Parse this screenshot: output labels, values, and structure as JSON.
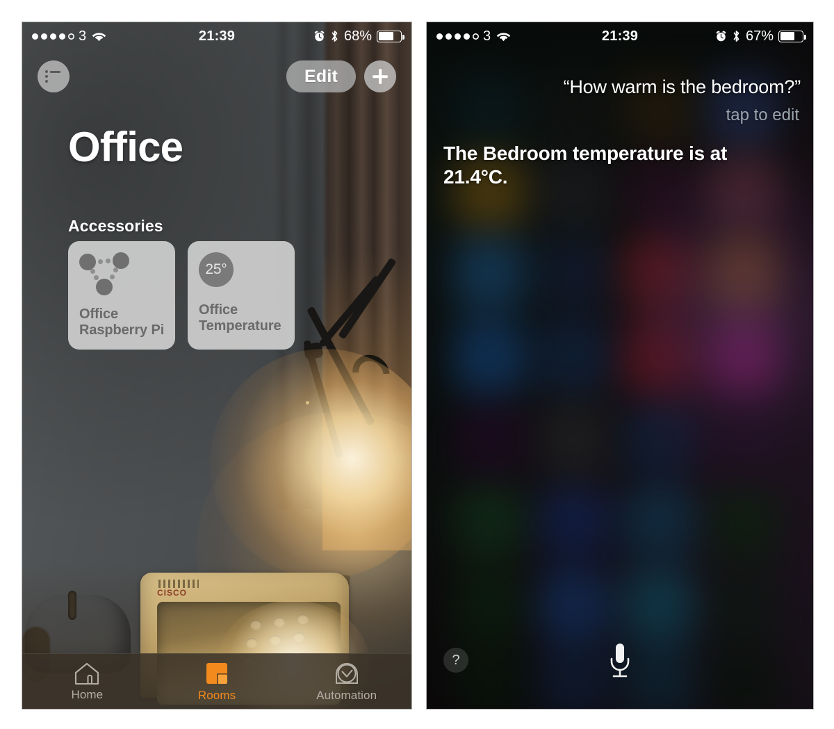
{
  "home_screen": {
    "status_bar": {
      "signal_dots_filled": 4,
      "signal_dots_total": 5,
      "carrier": "3",
      "wifi_icon": "wifi-icon",
      "time": "21:39",
      "alarm_icon": "alarm-clock-icon",
      "bluetooth_icon": "bluetooth-icon",
      "battery_percent": "68%",
      "battery_level": 68
    },
    "nav": {
      "list_icon": "list-icon",
      "edit_label": "Edit",
      "add_icon": "plus-icon"
    },
    "room_title": "Office",
    "accessories_header": "Accessories",
    "accessories": [
      {
        "icon": "raspberry-pi-icon",
        "name_line1": "Office",
        "name_line2": "Raspberry Pi"
      },
      {
        "icon": "temperature-badge",
        "badge_value": "25°",
        "name_line1": "Office",
        "name_line2": "Temperature"
      }
    ],
    "tab_bar": {
      "active": "Rooms",
      "accent_color": "#f28a1e",
      "inactive_color": "#b3ada3",
      "tabs": [
        {
          "label": "Home",
          "icon": "house-icon",
          "active": false
        },
        {
          "label": "Rooms",
          "icon": "rooms-icon",
          "active": true
        },
        {
          "label": "Automation",
          "icon": "automation-clock-icon",
          "active": false
        }
      ]
    }
  },
  "siri_screen": {
    "status_bar": {
      "signal_dots_filled": 4,
      "signal_dots_total": 5,
      "carrier": "3",
      "wifi_icon": "wifi-icon",
      "time": "21:39",
      "alarm_icon": "alarm-clock-icon",
      "bluetooth_icon": "bluetooth-icon",
      "battery_percent": "67%",
      "battery_level": 67
    },
    "query": "“How warm is the bedroom?”",
    "edit_hint": "tap to edit",
    "answer": "The Bedroom temperature is at 21.4°C.",
    "help_label": "?",
    "mic_icon": "microphone-icon"
  }
}
